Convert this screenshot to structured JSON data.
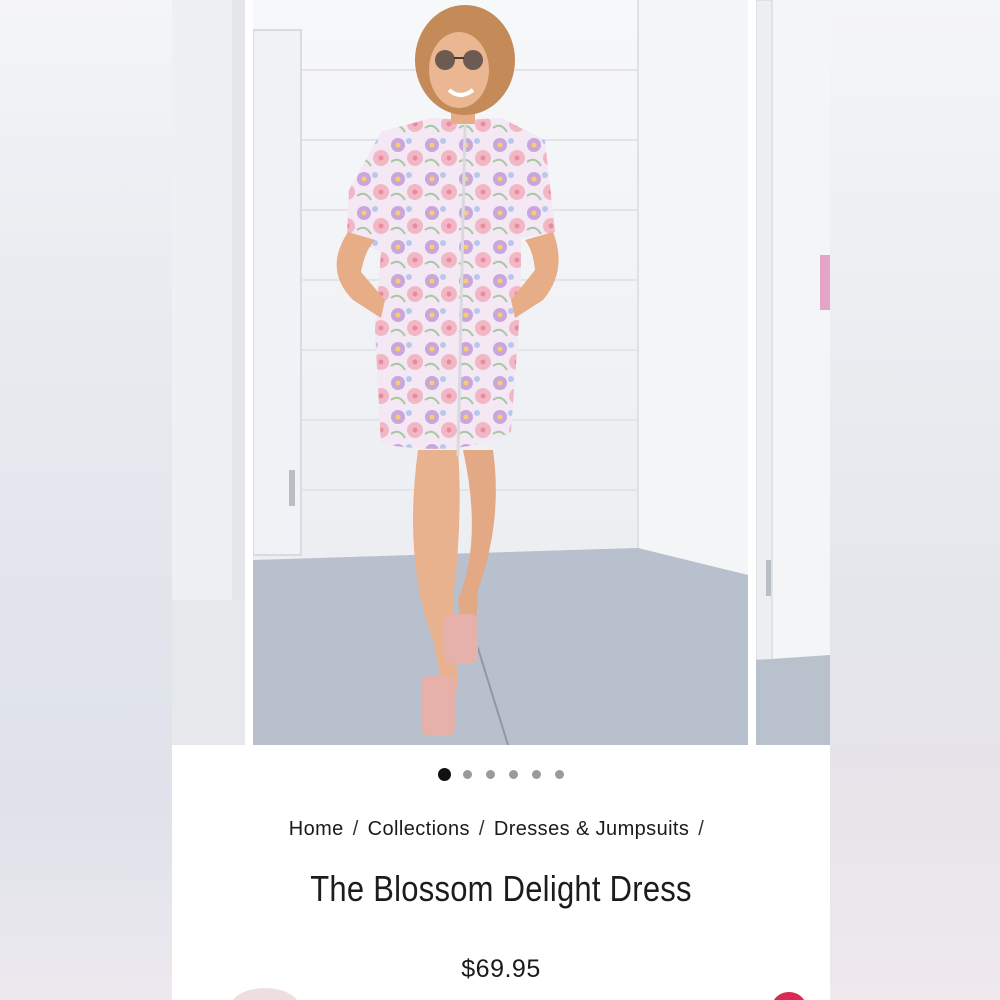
{
  "carousel": {
    "dot_count": 6,
    "active_index": 0,
    "zoom_icon": "magnifier-icon"
  },
  "breadcrumb": {
    "items": [
      "Home",
      "Collections",
      "Dresses & Jumpsuits"
    ],
    "separator": "/"
  },
  "product": {
    "title": "The Blossom Delight Dress",
    "price": "$69.95"
  },
  "colors": {
    "accent_badge": "#d92a52",
    "dot_active": "#111111",
    "dot_inactive": "#9a9a9a"
  }
}
